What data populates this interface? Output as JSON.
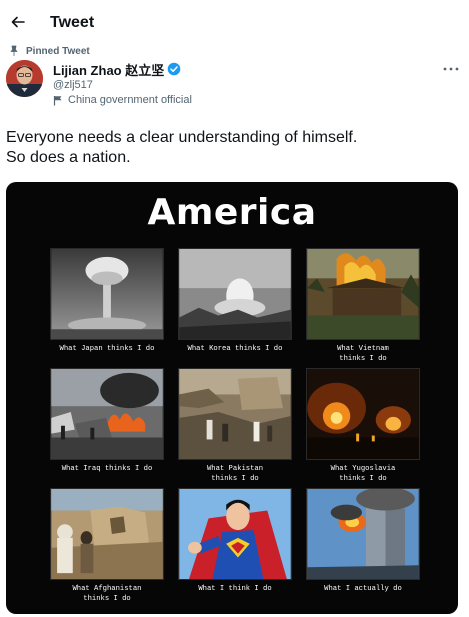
{
  "header": {
    "title": "Tweet",
    "back_icon": "back-arrow-icon"
  },
  "pinned_label": "Pinned Tweet",
  "author": {
    "name": "Lijian Zhao 赵立坚",
    "handle": "@zlj517",
    "label": "China government official",
    "verified": true
  },
  "tweet": {
    "line1": "Everyone needs a clear understanding of himself.",
    "line2": "So does a nation."
  },
  "meme": {
    "title": "America",
    "panels": [
      {
        "caption": "What Japan thinks I do",
        "picture": "mushroom-cloud"
      },
      {
        "caption": "What Korea thinks I do",
        "picture": "bombed-city"
      },
      {
        "caption": "What Vietnam\nthinks I do",
        "picture": "burning-hut"
      },
      {
        "caption": "What Iraq thinks I do",
        "picture": "burning-wreckage"
      },
      {
        "caption": "What Pakistan\nthinks I do",
        "picture": "rubble-crowd"
      },
      {
        "caption": "What Yugoslavia\nthinks I do",
        "picture": "night-fires"
      },
      {
        "caption": "What Afghanistan\nthinks I do",
        "picture": "ruined-village"
      },
      {
        "caption": "What I think I do",
        "picture": "superhero"
      },
      {
        "caption": "What I actually do",
        "picture": "burning-towers"
      }
    ]
  },
  "colors": {
    "accent": "#1d9bf0",
    "muted": "#536471",
    "text": "#0f1419"
  }
}
